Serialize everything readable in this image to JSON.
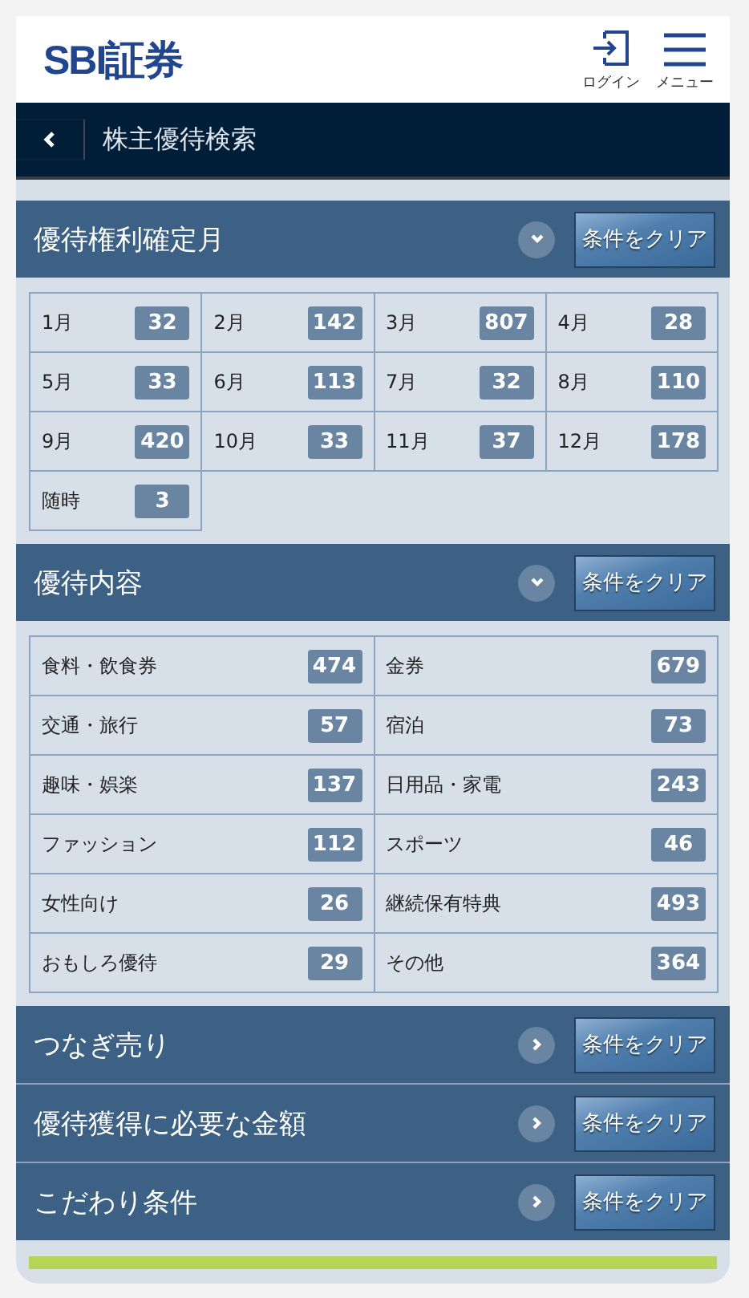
{
  "header": {
    "logo": "SBI証券",
    "login_label": "ログイン",
    "menu_label": "メニュー"
  },
  "nav": {
    "title": "株主優待検索"
  },
  "sections": [
    {
      "title": "優待権利確定月",
      "expanded": true,
      "kind": "month-grid",
      "clear_label": "条件をクリア",
      "items": [
        {
          "label": "1月",
          "count": "32"
        },
        {
          "label": "2月",
          "count": "142"
        },
        {
          "label": "3月",
          "count": "807"
        },
        {
          "label": "4月",
          "count": "28"
        },
        {
          "label": "5月",
          "count": "33"
        },
        {
          "label": "6月",
          "count": "113"
        },
        {
          "label": "7月",
          "count": "32"
        },
        {
          "label": "8月",
          "count": "110"
        },
        {
          "label": "9月",
          "count": "420"
        },
        {
          "label": "10月",
          "count": "33"
        },
        {
          "label": "11月",
          "count": "37"
        },
        {
          "label": "12月",
          "count": "178"
        },
        {
          "label": "随時",
          "count": "3"
        }
      ]
    },
    {
      "title": "優待内容",
      "expanded": true,
      "kind": "category-grid",
      "clear_label": "条件をクリア",
      "items": [
        {
          "label": "食料・飲食券",
          "count": "474"
        },
        {
          "label": "金券",
          "count": "679"
        },
        {
          "label": "交通・旅行",
          "count": "57"
        },
        {
          "label": "宿泊",
          "count": "73"
        },
        {
          "label": "趣味・娯楽",
          "count": "137"
        },
        {
          "label": "日用品・家電",
          "count": "243"
        },
        {
          "label": "ファッション",
          "count": "112"
        },
        {
          "label": "スポーツ",
          "count": "46"
        },
        {
          "label": "女性向け",
          "count": "26"
        },
        {
          "label": "継続保有特典",
          "count": "493"
        },
        {
          "label": "おもしろ優待",
          "count": "29"
        },
        {
          "label": "その他",
          "count": "364"
        }
      ]
    },
    {
      "title": "つなぎ売り",
      "expanded": false,
      "kind": "link",
      "clear_label": "条件をクリア"
    },
    {
      "title": "優待獲得に必要な金額",
      "expanded": false,
      "kind": "link",
      "clear_label": "条件をクリア"
    },
    {
      "title": "こだわり条件",
      "expanded": false,
      "kind": "link",
      "clear_label": "条件をクリア"
    }
  ]
}
